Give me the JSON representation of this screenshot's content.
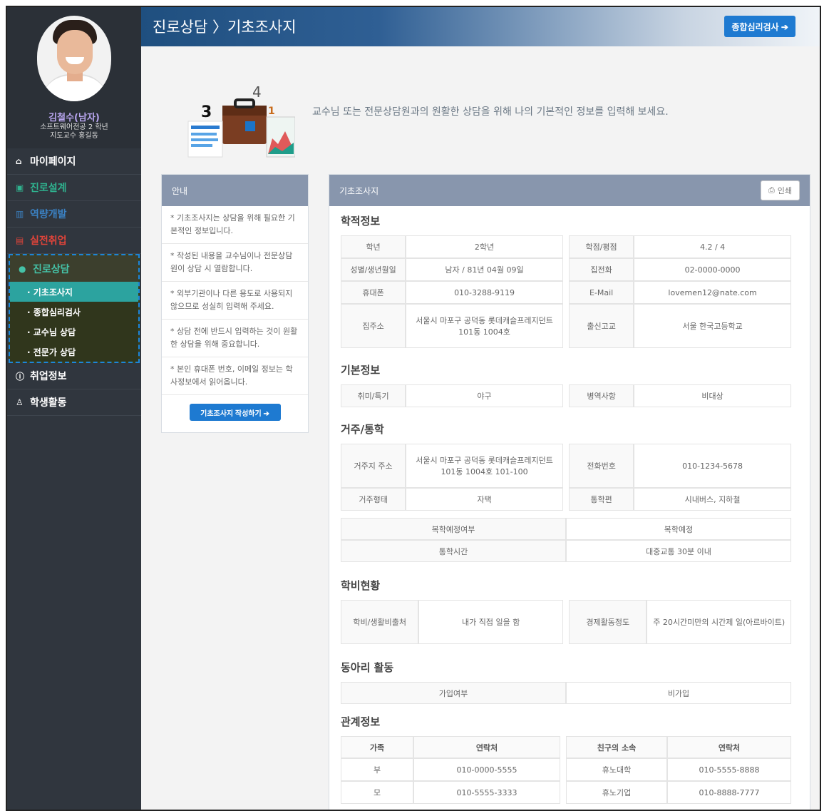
{
  "profile": {
    "name": "김철수(남자)",
    "dept": "소프트웨어전공 2 학년",
    "advisor": "지도교수 홍길동"
  },
  "menu": {
    "mypage": "마이페이지",
    "career_design": "진로설계",
    "ability": "역량개발",
    "job": "실전취업",
    "counsel": "진로상담",
    "sub": [
      "· 기초조사지",
      "· 종합심리검사",
      "· 교수님 상담",
      "· 전문가 상담"
    ],
    "employment": "취업정보",
    "activity": "학생활동"
  },
  "header": {
    "breadcrumb": "진로상담 〉기초조사지",
    "psych_button": "종합심리검사 ➔"
  },
  "intro": {
    "text": "교수님 또는 전문상담원과의 원활한 상담을 위해 나의 기본적인 정보를 입력해 보세요."
  },
  "guide": {
    "title": "안내",
    "items": [
      "* 기초조사지는 상담을 위해 필요한 기본적인 정보입니다.",
      "* 작성된 내용을 교수님이나 전문상담원이 상담 시 열람합니다.",
      "* 외부기관이나 다른 용도로 사용되지 않으므로 성실히 입력해 주세요.",
      "* 상담 전에 반드시 입력하는 것이 원활한 상담을 위해 중요합니다.",
      "* 본인 휴대폰 번호, 이메일 정보는 학사정보에서 읽어옵니다."
    ],
    "button": "기초조사지 작성하기 ➔"
  },
  "main": {
    "title": "기초조사지",
    "print": "인쇄",
    "academic": {
      "title": "학적정보",
      "rows": [
        [
          "학년",
          "2학년",
          "학점/평점",
          "4.2 / 4"
        ],
        [
          "성별/생년월일",
          "남자 / 81년 04월 09일",
          "집전화",
          "02-0000-0000"
        ],
        [
          "휴대폰",
          "010-3288-9119",
          "E-Mail",
          "lovemen12@nate.com"
        ],
        [
          "집주소",
          "서울시 마포구 공덕동 롯데캐슬프레지던트 101동 1004호",
          "출신고교",
          "서울 한국고등학교"
        ]
      ]
    },
    "basic": {
      "title": "기본정보",
      "rows": [
        [
          "취미/특기",
          "야구",
          "병역사항",
          "비대상"
        ]
      ]
    },
    "residence": {
      "title": "거주/통학",
      "rows": [
        [
          "거주지 주소",
          "서울시 마포구 공덕동 롯데캐슬프레지던트 101동 1004호 101-100",
          "전화번호",
          "010-1234-5678"
        ],
        [
          "거주형태",
          "자택",
          "통학편",
          "시내버스, 지하철"
        ]
      ],
      "rows2": [
        [
          "복학예정여부",
          "복학예정"
        ],
        [
          "통학시간",
          "대중교통 30분 이내"
        ]
      ]
    },
    "tuition": {
      "title": "학비현황",
      "rows": [
        [
          "학비/생활비출처",
          "내가 직접 일을 함",
          "경제활동정도",
          "주 20시간미만의 시간제 일(아르바이트)"
        ]
      ]
    },
    "club": {
      "title": "동아리 활동",
      "rows": [
        [
          "가입여부",
          "비가입"
        ]
      ]
    },
    "relation": {
      "title": "관계정보",
      "headers": [
        "가족",
        "연락처",
        "친구의 소속",
        "연락처"
      ],
      "rows": [
        [
          "부",
          "010-0000-5555",
          "휴노대학",
          "010-5555-8888"
        ],
        [
          "모",
          "010-5555-3333",
          "휴노기업",
          "010-8888-7777"
        ]
      ]
    }
  }
}
